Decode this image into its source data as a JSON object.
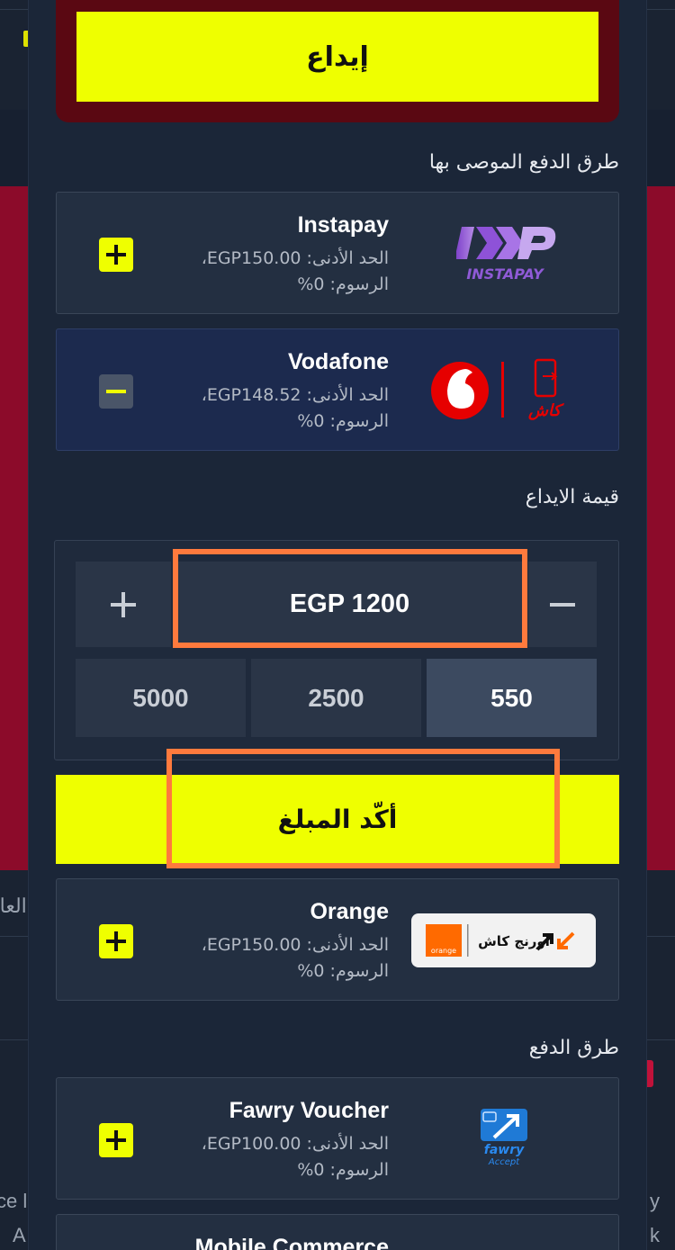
{
  "background": {
    "left_text_1": "العام",
    "left_text_2": "ce l",
    "left_text_3": "A",
    "right_text_1": "y",
    "right_text_2": "k"
  },
  "top_button": {
    "label": "إيداع"
  },
  "recommended": {
    "title": "طرق الدفع الموصى بها",
    "methods": [
      {
        "name": "Instapay",
        "min": "الحد الأدنى: EGP150.00،",
        "fee": "الرسوم: 0%",
        "logo_text": "INSTAPAY",
        "state": "plus"
      },
      {
        "name": "Vodafone",
        "min": "الحد الأدنى: EGP148.52،",
        "fee": "الرسوم: 0%",
        "logo_text": "كاش",
        "state": "minus"
      }
    ]
  },
  "amount": {
    "title": "قيمة الايداع",
    "value": "EGP 1200",
    "presets": [
      "550",
      "2500",
      "5000"
    ],
    "confirm_label": "أكّد المبلغ"
  },
  "orange": {
    "name": "Orange",
    "min": "الحد الأدنى: EGP150.00،",
    "fee": "الرسوم: 0%",
    "logo_text": "اورنج كاش",
    "logo_sub": "orange"
  },
  "payment_methods": {
    "title": "طرق الدفع",
    "methods": [
      {
        "name": "Fawry Voucher",
        "min": "الحد الأدنى: EGP100.00،",
        "fee": "الرسوم: 0%",
        "logo_text": "fawry",
        "logo_sub": "Accept"
      },
      {
        "name": "Mobile Commerce"
      }
    ]
  },
  "colors": {
    "accent_yellow": "#efff00",
    "highlight_orange": "#ff7a3d",
    "bg_red": "#8c0b2a",
    "vodafone_red": "#e60000"
  },
  "icons": {
    "plus": "plus-icon",
    "minus": "minus-icon"
  }
}
